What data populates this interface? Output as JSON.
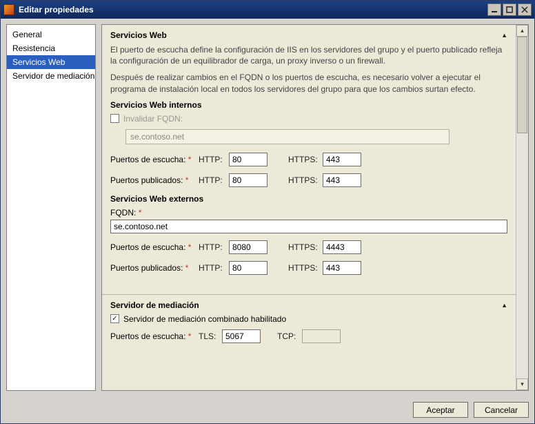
{
  "window": {
    "title": "Editar propiedades"
  },
  "sidebar": {
    "items": [
      {
        "label": "General"
      },
      {
        "label": "Resistencia"
      },
      {
        "label": "Servicios Web"
      },
      {
        "label": "Servidor de mediación"
      }
    ],
    "selected_index": 2
  },
  "sections": {
    "web": {
      "title": "Servicios Web",
      "desc1": "El puerto de escucha define la configuración de IIS en los servidores del grupo y el puerto publicado refleja la configuración de un equilibrador de carga, un proxy inverso o un firewall.",
      "desc2": "Después de realizar cambios en el FQDN o los puertos de escucha, es necesario volver a ejecutar el programa de instalación local en todos los servidores del grupo para que los cambios surtan efecto.",
      "internal": {
        "title": "Servicios Web internos",
        "override_label": "Invalidar FQDN:",
        "override_checked": false,
        "fqdn": "se.contoso.net",
        "listen_label": "Puertos de escucha:",
        "published_label": "Puertos publicados:",
        "http_label": "HTTP:",
        "https_label": "HTTPS:",
        "listen_http": "80",
        "listen_https": "443",
        "pub_http": "80",
        "pub_https": "443"
      },
      "external": {
        "title": "Servicios Web externos",
        "fqdn_label": "FQDN:",
        "fqdn": "se.contoso.net",
        "listen_label": "Puertos de escucha:",
        "published_label": "Puertos publicados:",
        "http_label": "HTTP:",
        "https_label": "HTTPS:",
        "listen_http": "8080",
        "listen_https": "4443",
        "pub_http": "80",
        "pub_https": "443"
      }
    },
    "mediation": {
      "title": "Servidor de mediación",
      "colocated_label": "Servidor de mediación combinado habilitado",
      "colocated_checked": true,
      "listen_label": "Puertos de escucha:",
      "tls_label": "TLS:",
      "tcp_label": "TCP:",
      "tls": "5067",
      "tcp": ""
    }
  },
  "buttons": {
    "ok": "Aceptar",
    "cancel": "Cancelar"
  }
}
